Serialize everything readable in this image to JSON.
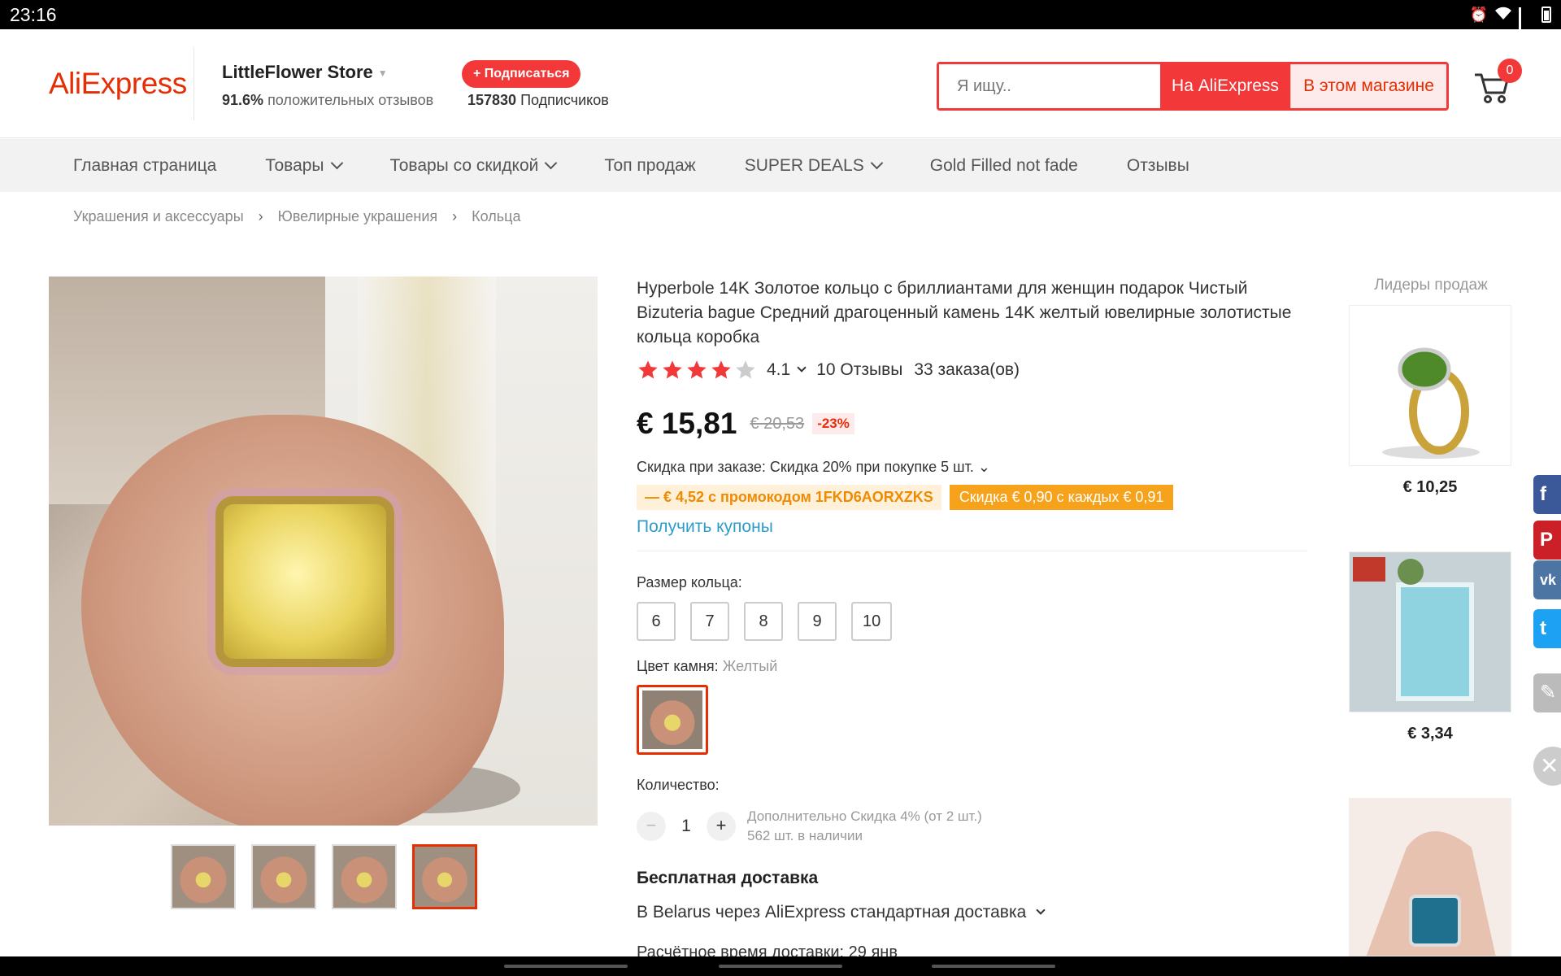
{
  "status_bar": {
    "time": "23:16"
  },
  "header": {
    "logo": "AliExpress",
    "store": {
      "name": "LittleFlower Store",
      "positive_pct": "91.6%",
      "positive_label": "положительных отзывов",
      "subscribe_label": "+ Подписаться",
      "subscribers_count": "157830",
      "subscribers_label": "Подписчиков"
    },
    "search": {
      "placeholder": "Я ищу..",
      "btn_aliexpress": "На AliExpress",
      "btn_store": "В этом магазине"
    },
    "cart_count": "0"
  },
  "nav": {
    "items": [
      {
        "label": "Главная страница",
        "dropdown": false
      },
      {
        "label": "Товары",
        "dropdown": true
      },
      {
        "label": "Товары со скидкой",
        "dropdown": true
      },
      {
        "label": "Топ продаж",
        "dropdown": false
      },
      {
        "label": "SUPER DEALS",
        "dropdown": true
      },
      {
        "label": "Gold Filled not fade",
        "dropdown": false
      },
      {
        "label": "Отзывы",
        "dropdown": false
      }
    ]
  },
  "breadcrumb": [
    "Украшения и аксессуары",
    "Ювелирные украшения",
    "Кольца"
  ],
  "product": {
    "title": "Hyperbole 14K Золотое кольцо с бриллиантами для женщин подарок Чистый Bizuteria bague Средний драгоценный камень 14K желтый ювелирные золотистые кольца коробка",
    "rating": "4.1",
    "stars_filled": 4,
    "reviews": "10 Отзывы",
    "orders": "33 заказа(ов)",
    "price": "€ 15,81",
    "old_price": "€ 20,53",
    "discount": "-23%",
    "bulk_discount": "Скидка при заказе: Скидка 20% при покупке 5 шт.",
    "promo_code": "— € 4,52 с промокодом 1FKD6AORXZKS",
    "promo_store": "Скидка € 0,90 с каждых € 0,91",
    "coupons_link": "Получить купоны",
    "size_label": "Размер кольца:",
    "sizes": [
      "6",
      "7",
      "8",
      "9",
      "10"
    ],
    "color_label": "Цвет камня:",
    "color_value": "Желтый",
    "qty_label": "Количество:",
    "qty_value": "1",
    "qty_minus": "−",
    "qty_plus": "+",
    "qty_extra": "Дополнительно Скидка 4% (от 2 шт.)",
    "stock": "562 шт. в наличии",
    "shipping_title": "Бесплатная доставка",
    "shipping_desc": "В Belarus через AliExpress стандартная доставка",
    "eta": "Расчётное время доставки: 29 янв"
  },
  "best_sellers": {
    "title": "Лидеры продаж",
    "items": [
      {
        "price": "€ 10,25",
        "stone": "#4f8a2a"
      },
      {
        "price": "€ 3,34",
        "stone": "#8fd3e0"
      },
      {
        "price": "",
        "stone": "#1f6f8f"
      }
    ]
  },
  "social": {
    "facebook": "f",
    "pinterest": "P",
    "vk": "vk",
    "twitter": "t",
    "edit": "✎",
    "close": "✕",
    "colors": {
      "facebook": "#3b5998",
      "pinterest": "#cb2027",
      "vk": "#4c75a3",
      "twitter": "#1da1f2",
      "edit": "#bbbbbb"
    }
  },
  "colors": {
    "accent": "#f23838",
    "brand": "#e62e04",
    "link": "#2e9cca",
    "promo": "#f7a21b"
  }
}
